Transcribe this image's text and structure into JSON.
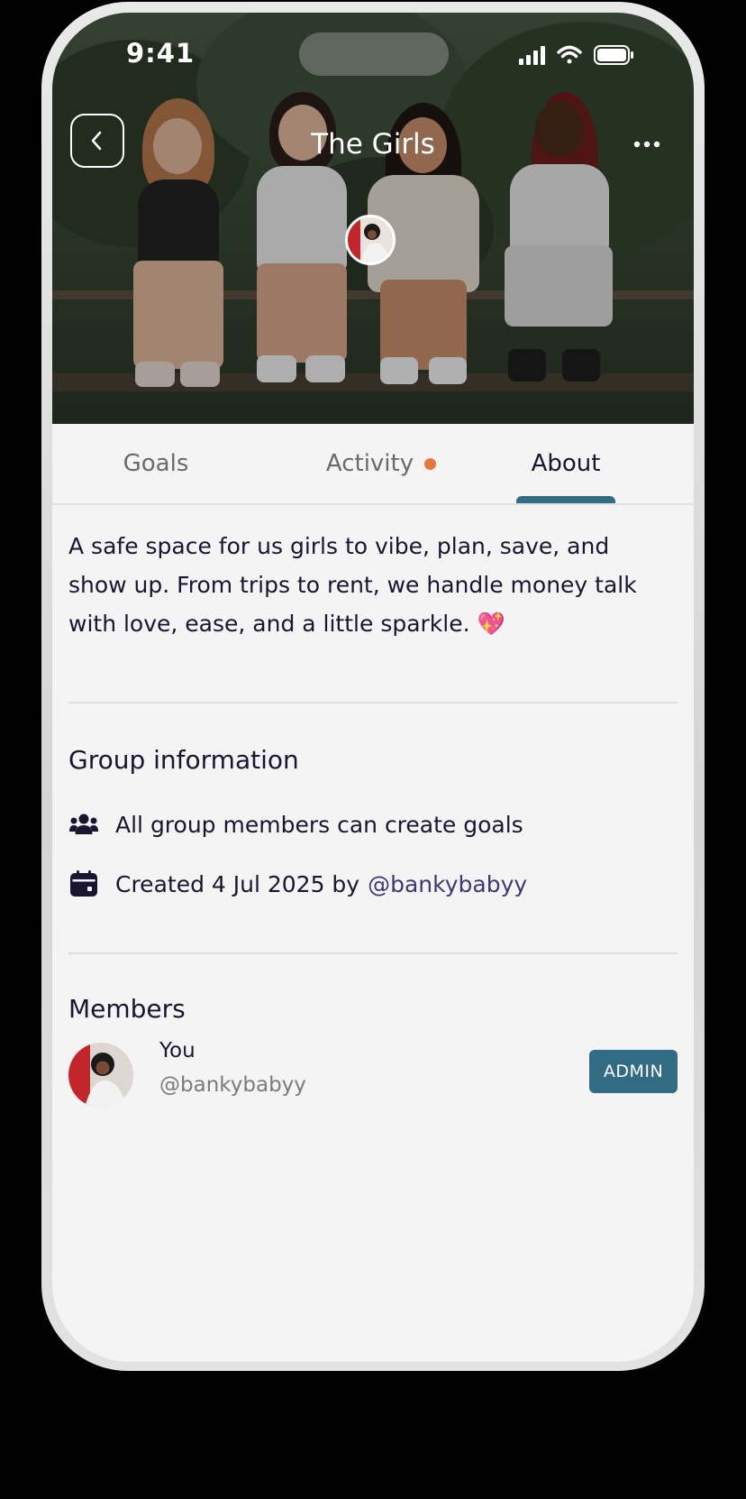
{
  "status_bar": {
    "time": "9:41"
  },
  "header": {
    "title": "The Girls",
    "back_icon": "chevron-left-icon",
    "more_icon": "more-horizontal-icon"
  },
  "tabs": [
    {
      "label": "Goals",
      "active": false
    },
    {
      "label": "Activity",
      "active": false,
      "has_notification_dot": true
    },
    {
      "label": "About",
      "active": true
    }
  ],
  "about": {
    "description": "A safe space for us girls to vibe, plan, save, and show up. From trips to rent, we handle money talk with love, ease, and a little sparkle. 💖"
  },
  "group_information": {
    "title": "Group information",
    "permissions": "All group members can create goals",
    "created_prefix": "Created 4 Jul 2025 by",
    "created_by": "@bankybabyy"
  },
  "members": {
    "title": "Members",
    "list": [
      {
        "name": "You",
        "handle": "@bankybabyy",
        "role": "ADMIN"
      }
    ]
  },
  "colors": {
    "accent": "#316b84",
    "notification_dot": "#e8763a",
    "text_primary": "#1a1530",
    "link": "#3d3877",
    "background": "#f4f4f4"
  }
}
